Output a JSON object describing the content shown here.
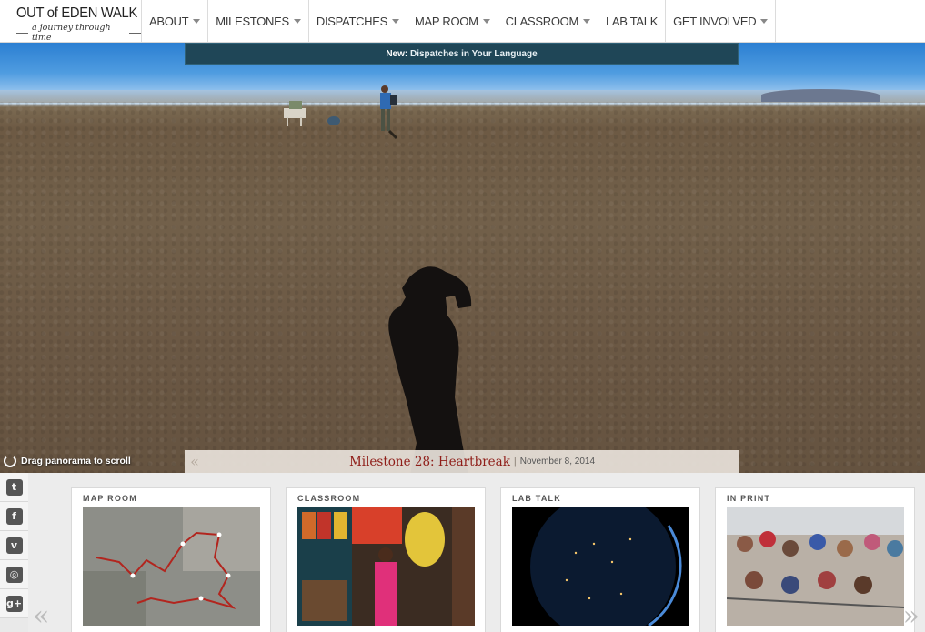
{
  "brand": {
    "title": "OUT of EDEN WALK",
    "tagline": "a journey through time"
  },
  "nav": {
    "items": [
      {
        "label": "ABOUT",
        "has_dropdown": true
      },
      {
        "label": "MILESTONES",
        "has_dropdown": true
      },
      {
        "label": "DISPATCHES",
        "has_dropdown": true
      },
      {
        "label": "MAP ROOM",
        "has_dropdown": true
      },
      {
        "label": "CLASSROOM",
        "has_dropdown": true
      },
      {
        "label": "LAB TALK",
        "has_dropdown": false
      },
      {
        "label": "GET INVOLVED",
        "has_dropdown": true
      }
    ]
  },
  "announcement": {
    "prefix": "New:",
    "text": "Dispatches in Your Language"
  },
  "hero": {
    "drag_hint": "Drag panorama to scroll"
  },
  "milestone": {
    "title": "Milestone 28: Heartbreak",
    "separator": "|",
    "date": "November 8, 2014",
    "prev_glyph": "«"
  },
  "social": {
    "items": [
      {
        "name": "twitter",
        "glyph": "t"
      },
      {
        "name": "facebook",
        "glyph": "f"
      },
      {
        "name": "vimeo",
        "glyph": "v"
      },
      {
        "name": "instagram",
        "glyph": "◎"
      },
      {
        "name": "google-plus",
        "glyph": "g+"
      }
    ]
  },
  "cards": [
    {
      "label": "MAP ROOM"
    },
    {
      "label": "CLASSROOM"
    },
    {
      "label": "LAB TALK"
    },
    {
      "label": "IN PRINT"
    }
  ],
  "carousel": {
    "prev_glyph": "«",
    "next_glyph": "»"
  },
  "colors": {
    "announce_bg": "#1f4657",
    "milestone_title": "#8f1d18",
    "sky": "#2b7fd2",
    "ground": "#6d5a44"
  }
}
